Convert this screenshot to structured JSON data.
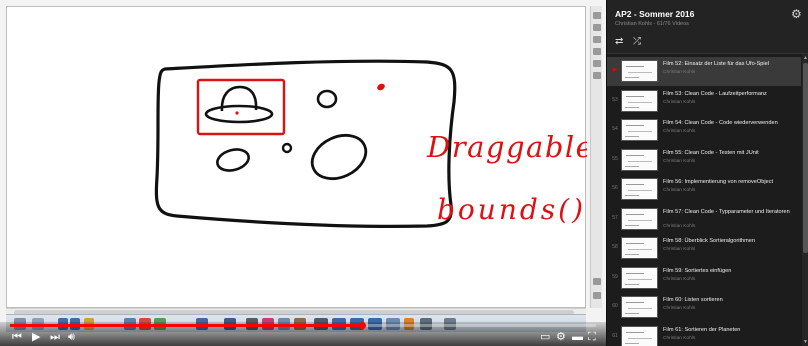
{
  "whiteboard": {
    "handwriting_line1": "Draggable",
    "handwriting_line2": "bounds()"
  },
  "player": {
    "progress_fraction": 0.6
  },
  "playlist": {
    "title": "AP2 - Sommer 2016",
    "subtitle": "Christian Kohls - 61/76 Videos",
    "icons": {
      "loop": "loop-icon",
      "shuffle": "shuffle-icon",
      "settings": "gear-icon"
    },
    "items": [
      {
        "number": "▶",
        "title": "Film 52: Einsatz der Liste für das Ufo-Spiel",
        "author": "Christian Kohls",
        "active": true
      },
      {
        "number": "53",
        "title": "Film 53: Clean Code - Laufzeitperformanz",
        "author": "Christian Kohls",
        "active": false
      },
      {
        "number": "54",
        "title": "Film 54: Clean Code - Code wiederverwenden",
        "author": "Christian Kohls",
        "active": false
      },
      {
        "number": "55",
        "title": "Film 55: Clean Code - Testen mit JUnit",
        "author": "Christian Kohls",
        "active": false
      },
      {
        "number": "56",
        "title": "Film 56: Implementierung von removeObject",
        "author": "Christian Kohls",
        "active": false
      },
      {
        "number": "57",
        "title": "Film 57: Clean Code - Typparameter und Iteratoren",
        "author": "Christian Kohls",
        "active": false
      },
      {
        "number": "58",
        "title": "Film 58: Überblick Sortieralgorithmen",
        "author": "Christian Kohls",
        "active": false
      },
      {
        "number": "59",
        "title": "Film 59: Sortiertes einfügen",
        "author": "Christian Kohls",
        "active": false
      },
      {
        "number": "60",
        "title": "Film 60: Listen sortieren",
        "author": "Christian Kohls",
        "active": false
      },
      {
        "number": "61",
        "title": "Film 61: Sortieren der Planeten",
        "author": "Christian Kohls",
        "active": false
      }
    ]
  }
}
